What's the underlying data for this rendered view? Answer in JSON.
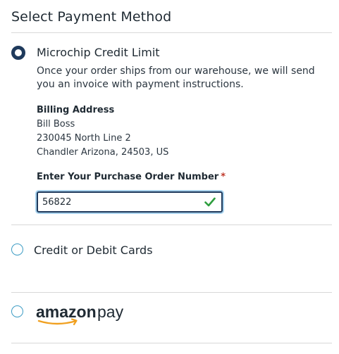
{
  "section": {
    "title": "Select Payment Method"
  },
  "options": [
    {
      "label": "Microchip Credit Limit",
      "selected": true,
      "description": "Once your order ships from our warehouse, we will send you an invoice with payment instructions.",
      "billing": {
        "heading": "Billing Address",
        "lines": [
          "Bill Boss",
          "230045 North Line 2",
          "Chandler Arizona, 24503, US"
        ]
      },
      "po": {
        "label": "Enter Your Purchase Order Number",
        "required_mark": "*",
        "value": "56822",
        "valid": true
      }
    },
    {
      "label": "Credit or Debit Cards",
      "selected": false
    },
    {
      "label": "amazon pay",
      "selected": false
    }
  ],
  "colors": {
    "selected_radio": "#1f3a5c",
    "radio_border": "#3d9cc4",
    "valid_check": "#2e9e3e",
    "required": "#c0392b"
  }
}
